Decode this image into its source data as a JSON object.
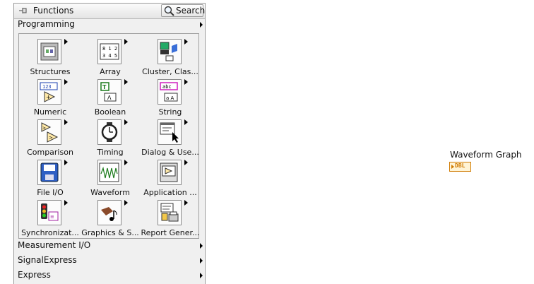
{
  "palette": {
    "title": "Functions",
    "search_label": "Search",
    "top_category": "Programming",
    "tiles": [
      {
        "label": "Structures",
        "icon": "structures-icon"
      },
      {
        "label": "Array",
        "icon": "array-icon"
      },
      {
        "label": "Cluster, Clas...",
        "icon": "cluster-class-icon"
      },
      {
        "label": "Numeric",
        "icon": "numeric-icon"
      },
      {
        "label": "Boolean",
        "icon": "boolean-icon"
      },
      {
        "label": "String",
        "icon": "string-icon"
      },
      {
        "label": "Comparison",
        "icon": "comparison-icon"
      },
      {
        "label": "Timing",
        "icon": "timing-icon"
      },
      {
        "label": "Dialog & Use...",
        "icon": "dialog-user-interface-icon"
      },
      {
        "label": "File I/O",
        "icon": "file-io-icon"
      },
      {
        "label": "Waveform",
        "icon": "waveform-icon"
      },
      {
        "label": "Application ...",
        "icon": "application-control-icon"
      },
      {
        "label": "Synchronizat...",
        "icon": "synchronization-icon"
      },
      {
        "label": "Graphics & S...",
        "icon": "graphics-sound-icon"
      },
      {
        "label": "Report Gener...",
        "icon": "report-generation-icon"
      }
    ],
    "bottom_categories": [
      "Measurement I/O",
      "SignalExpress",
      "Express"
    ]
  },
  "diagram": {
    "node_label": "Waveform Graph",
    "terminal_type": "DBL"
  },
  "colors": {
    "terminal_orange": "#d07a00",
    "palette_bg": "#f0f0f0"
  }
}
